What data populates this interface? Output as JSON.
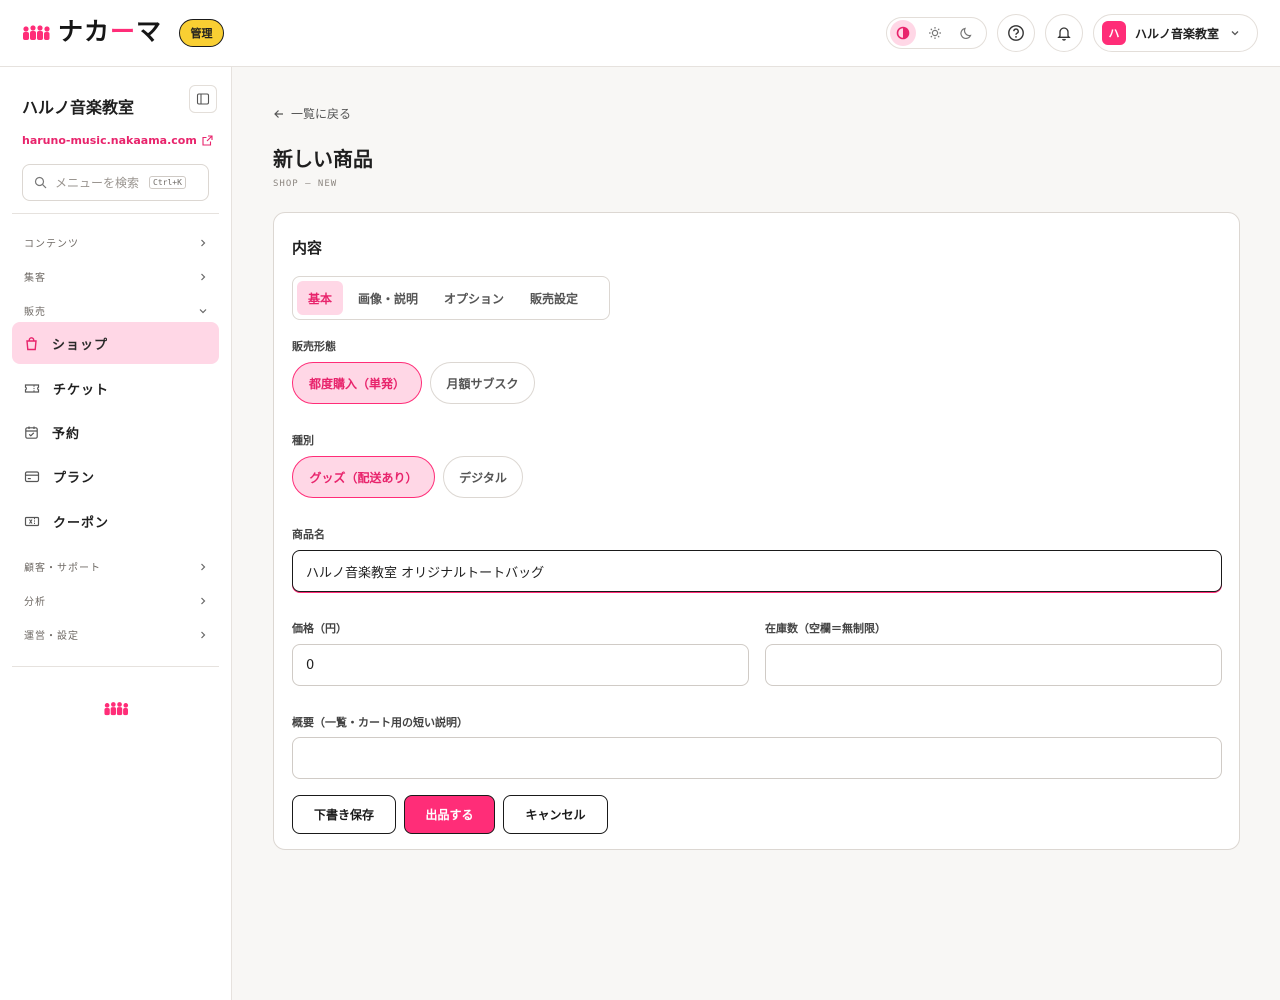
{
  "header": {
    "logo_text_a": "ナカ",
    "logo_text_b": "ー",
    "logo_text_c": "マ",
    "admin_badge": "管理",
    "account_initial": "ハ",
    "account_name": "ハルノ音楽教室"
  },
  "sidebar": {
    "site_name": "ハルノ音楽教室",
    "site_url": "haruno-music.nakaama.com",
    "search_placeholder": "メニューを検索",
    "search_shortcut": "Ctrl+K",
    "sections": [
      {
        "label": "コンテンツ"
      },
      {
        "label": "集客"
      },
      {
        "label": "販売"
      },
      {
        "label": "顧客・サポート"
      },
      {
        "label": "分析"
      },
      {
        "label": "運営・設定"
      }
    ],
    "items": [
      {
        "label": "ショップ",
        "icon": "shopping-bag-icon"
      },
      {
        "label": "チケット",
        "icon": "ticket-icon"
      },
      {
        "label": "予約",
        "icon": "calendar-icon"
      },
      {
        "label": "プラン",
        "icon": "credit-card-icon"
      },
      {
        "label": "クーポン",
        "icon": "coupon-icon"
      }
    ]
  },
  "main": {
    "back_label": "一覧に戻る",
    "title": "新しい商品",
    "crumb": "SHOP — NEW",
    "card_title": "内容",
    "tabs": [
      {
        "label": "基本"
      },
      {
        "label": "画像・説明"
      },
      {
        "label": "オプション"
      },
      {
        "label": "販売設定"
      }
    ],
    "sale_type_label": "販売形態",
    "sale_type_options": [
      "都度購入（単発）",
      "月額サブスク"
    ],
    "kind_label": "種別",
    "kind_options": [
      "グッズ（配送あり）",
      "デジタル"
    ],
    "name_label": "商品名",
    "name_value": "ハルノ音楽教室 オリジナルトートバッグ",
    "price_label": "価格（円）",
    "price_value": "0",
    "stock_label": "在庫数（空欄＝無制限）",
    "stock_value": "",
    "summary_label": "概要（一覧・カート用の短い説明）",
    "summary_value": "",
    "buttons": {
      "draft": "下書き保存",
      "publish": "出品する",
      "cancel": "キャンセル"
    }
  },
  "colors": {
    "accent": "#ff2d78",
    "accent_soft": "#ffd7e6",
    "badge": "#f9cf33",
    "background": "#f8f7f5"
  }
}
